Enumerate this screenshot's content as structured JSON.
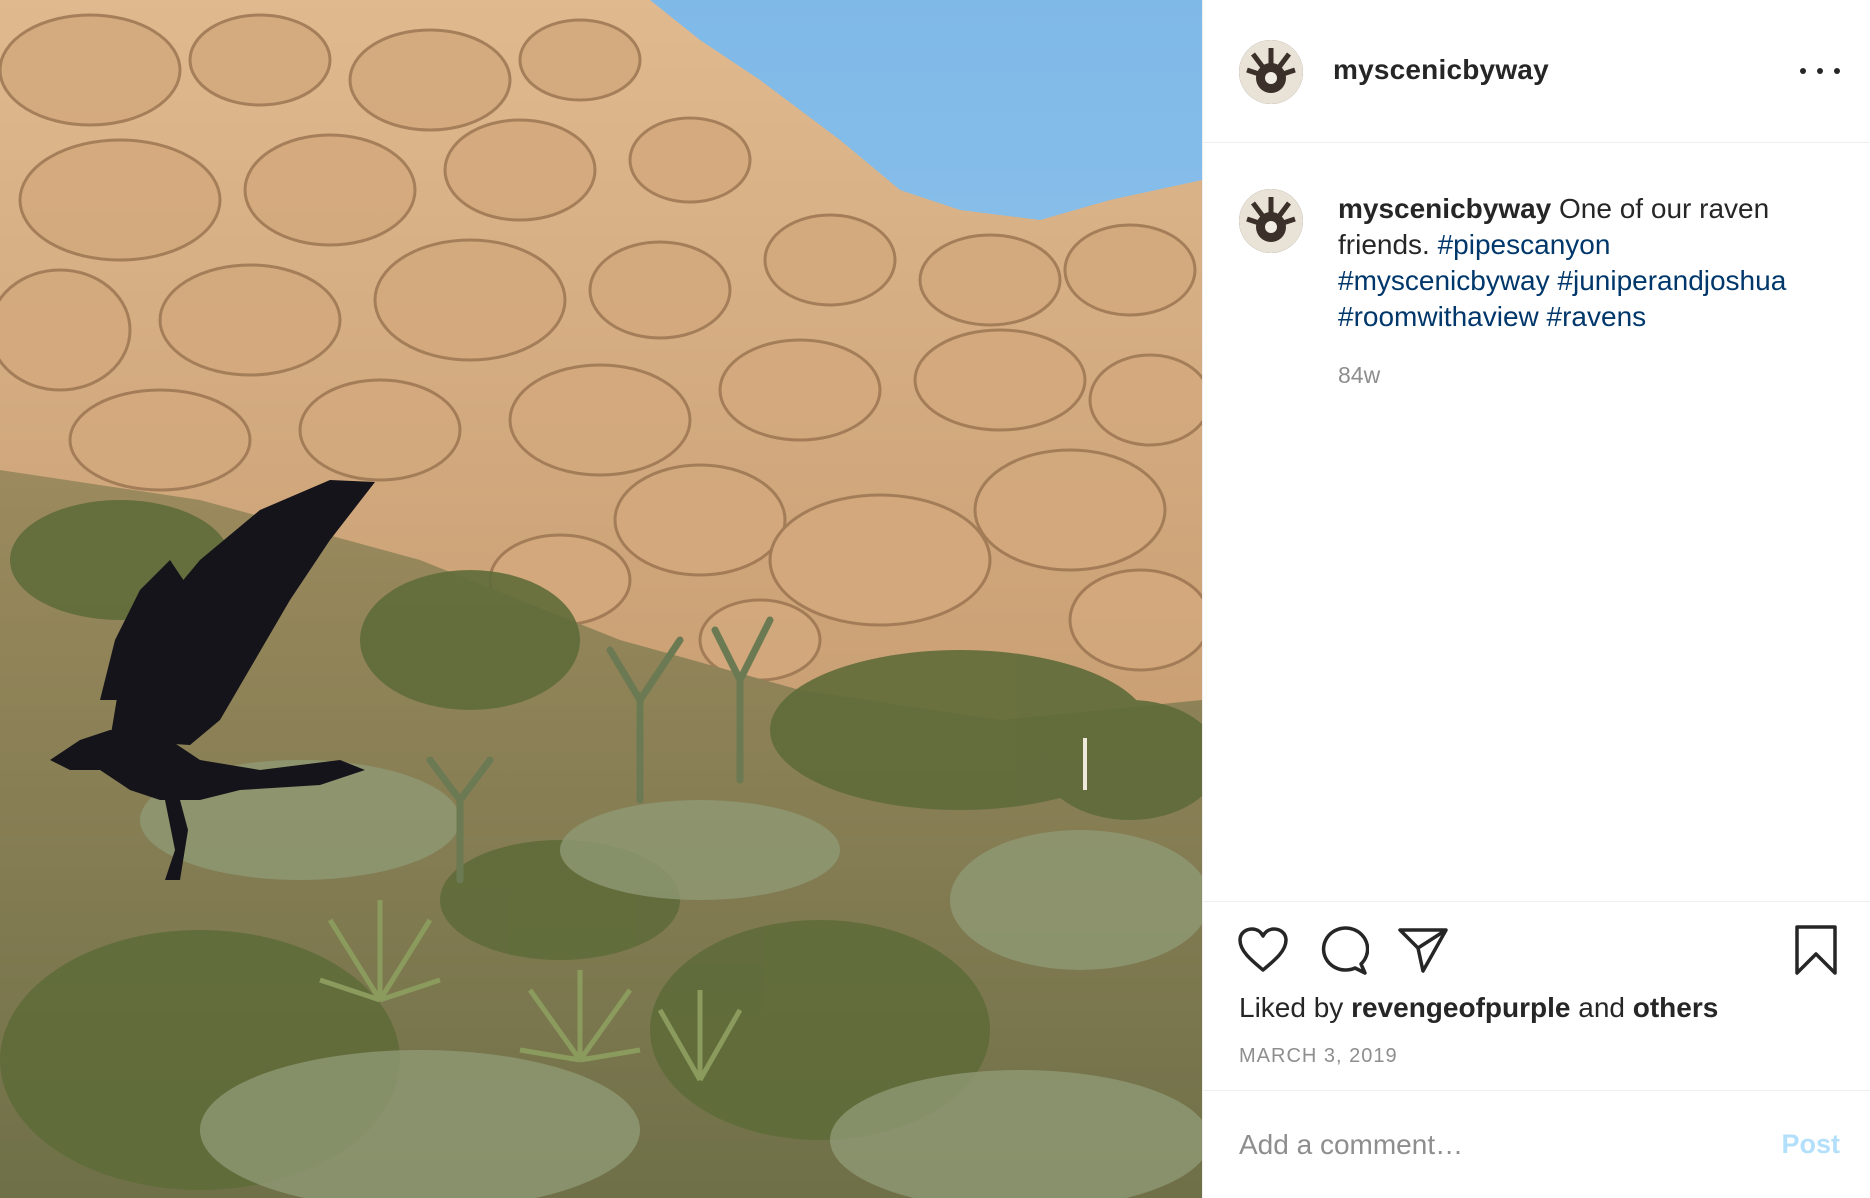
{
  "post": {
    "image_subject": "photo",
    "author": "myscenicbyway",
    "caption": {
      "username": "myscenicbyway",
      "text": "One of our raven friends.",
      "hashtags": [
        "#pipescanyon",
        "#myscenicbyway",
        "#juniperandjoshua",
        "#roomwithaview",
        "#ravens"
      ]
    },
    "time_ago": "84w",
    "likes": {
      "prefix": "Liked by",
      "user": "revengeofpurple",
      "middle": "and",
      "suffix": "others"
    },
    "date": "MARCH 3, 2019"
  },
  "comment": {
    "placeholder": "Add a comment…",
    "post_label": "Post"
  },
  "icons": {
    "more": "more-options-icon",
    "like": "heart-icon",
    "comment": "comment-icon",
    "share": "paper-plane-icon",
    "save": "bookmark-icon"
  },
  "colors": {
    "hashtag": "#00376b",
    "post_disabled": "#b2dffc",
    "muted": "#8e8e8e",
    "sky": "#8fc3ea"
  }
}
